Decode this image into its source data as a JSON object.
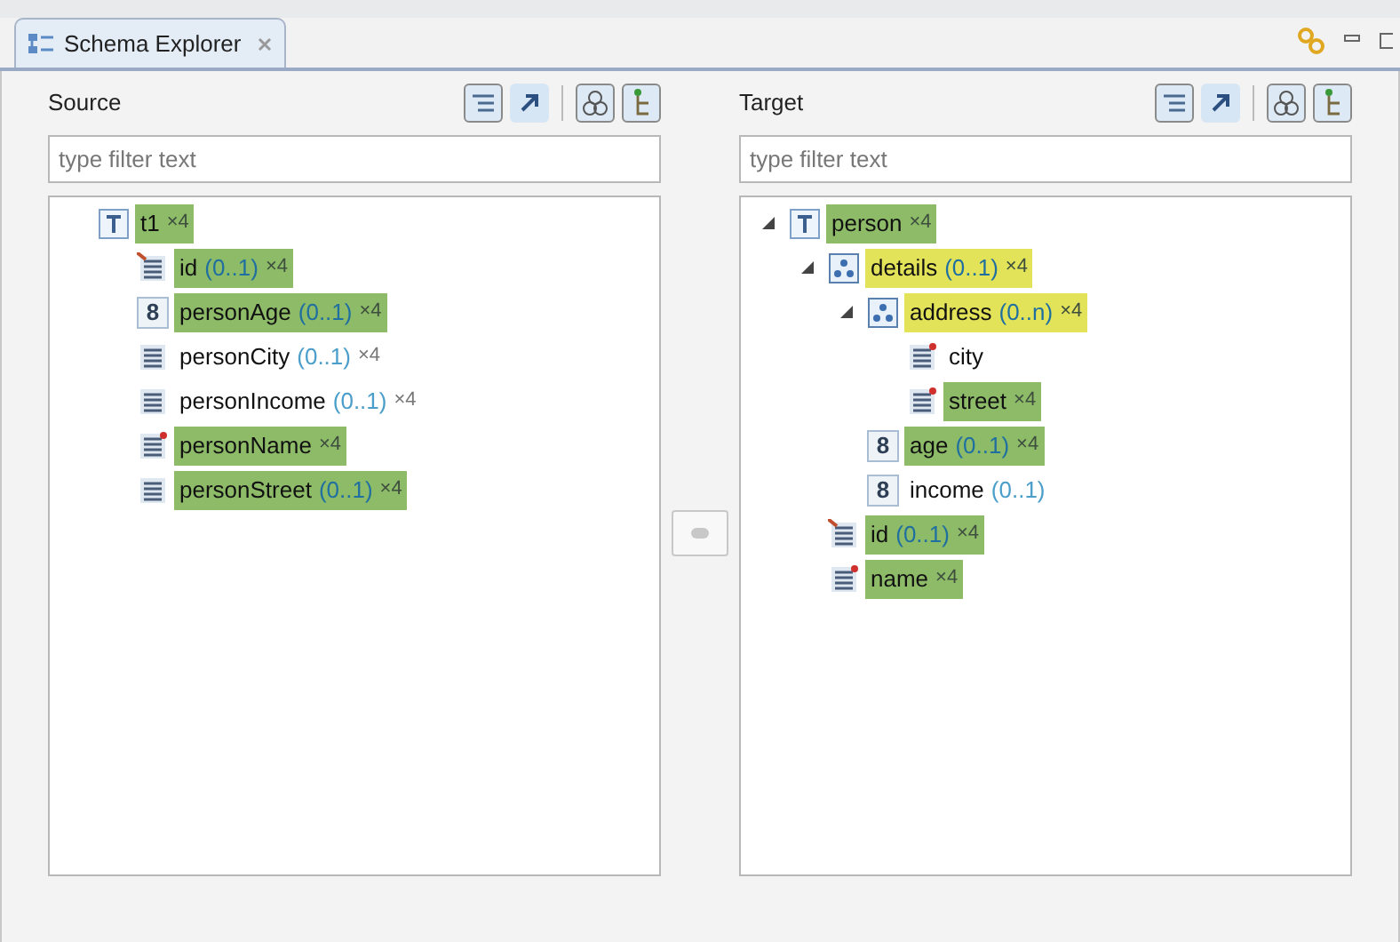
{
  "tab": {
    "title": "Schema Explorer",
    "selected": true
  },
  "panels": [
    {
      "title": "Source",
      "filter": {
        "placeholder": "type filter text"
      },
      "tree": [
        {
          "kind": "table",
          "label": "t1",
          "count": "×4",
          "color": "#8dbb68",
          "children": [
            {
              "kind": "key",
              "label": "id",
              "cardinality": "(0..1)",
              "count": "×4",
              "color": "#8dbb68"
            },
            {
              "kind": "number",
              "glyph": "8",
              "label": "personAge",
              "cardinality": "(0..1)",
              "count": "×4",
              "color": "#8dbb68"
            },
            {
              "kind": "text",
              "label": "personCity",
              "cardinality": "(0..1)",
              "count": "×4"
            },
            {
              "kind": "text",
              "label": "personIncome",
              "cardinality": "(0..1)",
              "count": "×4"
            },
            {
              "kind": "marked",
              "label": "personName",
              "count": "×4",
              "color": "#8dbb68"
            },
            {
              "kind": "text",
              "label": "personStreet",
              "cardinality": "(0..1)",
              "count": "×4",
              "color": "#8dbb68"
            }
          ]
        }
      ]
    },
    {
      "title": "Target",
      "filter": {
        "placeholder": "type filter text"
      },
      "tree": [
        {
          "kind": "table",
          "label": "person",
          "count": "×4",
          "color": "#8dbb68",
          "expanded": true,
          "children": [
            {
              "kind": "group",
              "label": "details",
              "cardinality": "(0..1)",
              "count": "×4",
              "color": "#e3e35a",
              "expanded": true,
              "children": [
                {
                  "kind": "group",
                  "label": "address",
                  "cardinality": "(0..n)",
                  "count": "×4",
                  "color": "#e3e35a",
                  "expanded": true,
                  "children": [
                    {
                      "kind": "marked",
                      "label": "city"
                    },
                    {
                      "kind": "marked",
                      "label": "street",
                      "count": "×4",
                      "color": "#8dbb68"
                    }
                  ]
                },
                {
                  "kind": "number",
                  "glyph": "8",
                  "label": "age",
                  "cardinality": "(0..1)",
                  "count": "×4",
                  "color": "#8dbb68"
                },
                {
                  "kind": "number",
                  "glyph": "8",
                  "label": "income",
                  "cardinality": "(0..1)"
                }
              ]
            },
            {
              "kind": "key",
              "label": "id",
              "cardinality": "(0..1)",
              "count": "×4",
              "color": "#8dbb68"
            },
            {
              "kind": "marked",
              "label": "name",
              "count": "×4",
              "color": "#8dbb68"
            }
          ]
        }
      ]
    }
  ]
}
